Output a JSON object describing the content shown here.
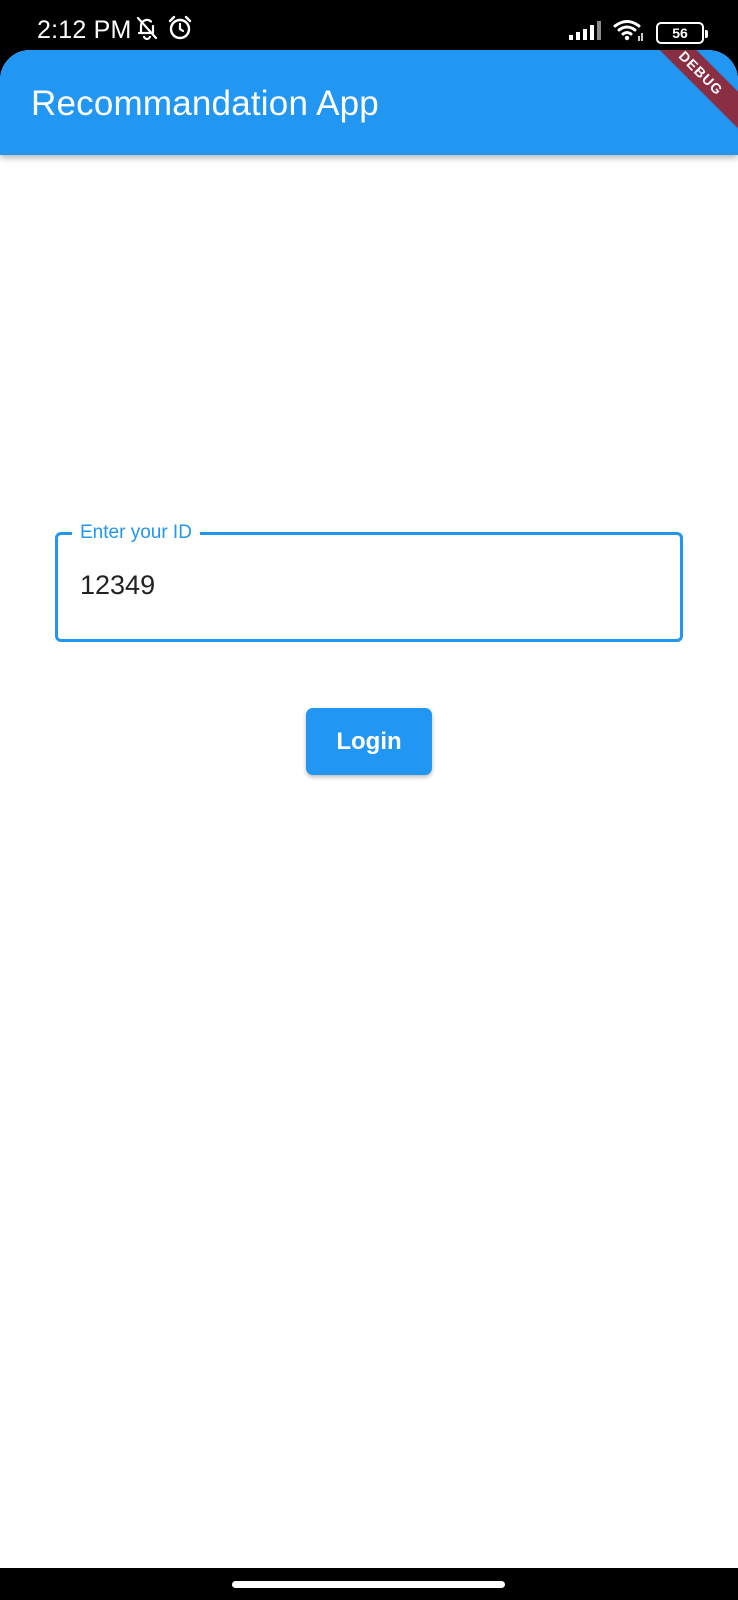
{
  "status_bar": {
    "time": "2:12 PM",
    "icons_left": [
      "notifications-off-icon",
      "alarm-icon"
    ],
    "icons_right": [
      "signal-icon",
      "wifi-icon",
      "battery-icon"
    ],
    "battery_level": "56"
  },
  "app_bar": {
    "title": "Recommandation App",
    "debug_banner": "DEBUG",
    "color": "#2196f3"
  },
  "login_form": {
    "id_field": {
      "label": "Enter your ID",
      "value": "12349"
    },
    "login_button_label": "Login"
  },
  "colors": {
    "primary": "#2196f3",
    "debug_banner": "#8a2f43"
  }
}
